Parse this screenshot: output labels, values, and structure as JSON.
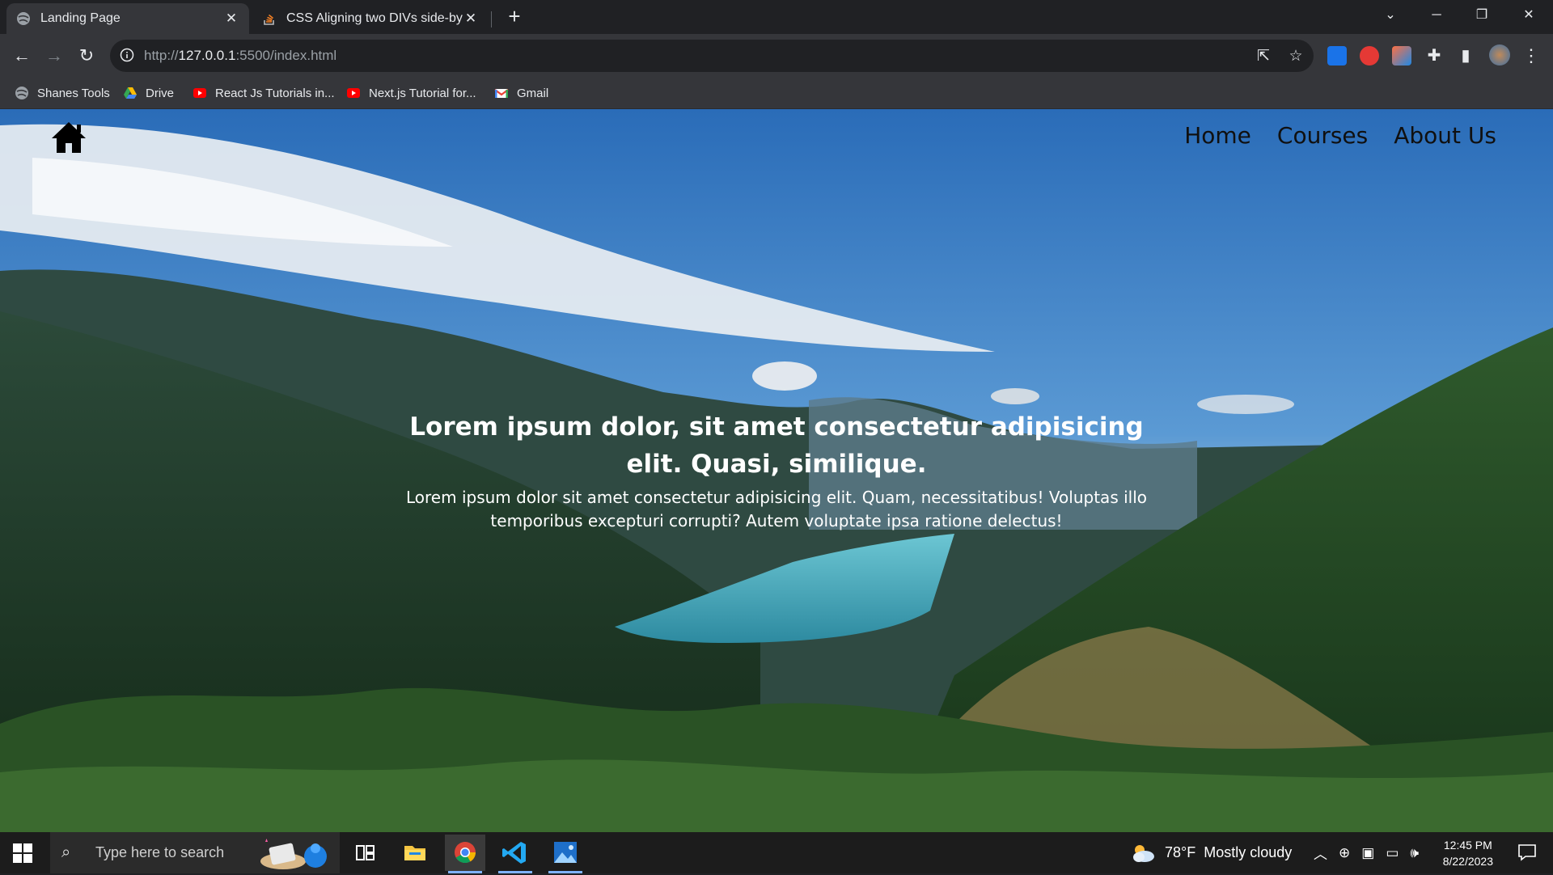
{
  "browser": {
    "tabs": [
      {
        "title": "Landing Page",
        "active": true,
        "icon": "globe-icon"
      },
      {
        "title": "CSS Aligning two DIVs side-by-si",
        "active": false,
        "icon": "stackoverflow-icon"
      }
    ],
    "url": {
      "scheme": "http://",
      "host": "127.0.0.1",
      "rest": ":5500/index.html"
    },
    "bookmarks": [
      {
        "label": "Shanes Tools",
        "icon": "globe-icon"
      },
      {
        "label": "Drive",
        "icon": "google-drive-icon"
      },
      {
        "label": "React Js Tutorials in...",
        "icon": "youtube-icon"
      },
      {
        "label": "Next.js Tutorial for...",
        "icon": "youtube-icon"
      },
      {
        "label": "Gmail",
        "icon": "gmail-icon"
      }
    ]
  },
  "page": {
    "nav": [
      "Home",
      "Courses",
      "About Us"
    ],
    "hero_title": "Lorem ipsum dolor, sit amet consectetur adipisicing elit. Quasi, similique.",
    "hero_text": "Lorem ipsum dolor sit amet consectetur adipisicing elit. Quam, necessitatibus! Voluptas illo temporibus excepturi corrupti? Autem voluptate ipsa ratione delectus!",
    "nav_color": "#101010",
    "hero_color": "#ffffff"
  },
  "taskbar": {
    "search_placeholder": "Type here to search",
    "weather": {
      "temp": "78°F",
      "desc": "Mostly cloudy"
    },
    "time": "12:45 PM",
    "date": "8/22/2023",
    "apps": [
      "task-view-icon",
      "file-explorer-icon",
      "chrome-icon",
      "vscode-icon",
      "photos-icon"
    ]
  },
  "colors": {
    "tab_active": "#35363a",
    "tabstrip": "#202124",
    "taskbar": "#1c1c1c"
  }
}
